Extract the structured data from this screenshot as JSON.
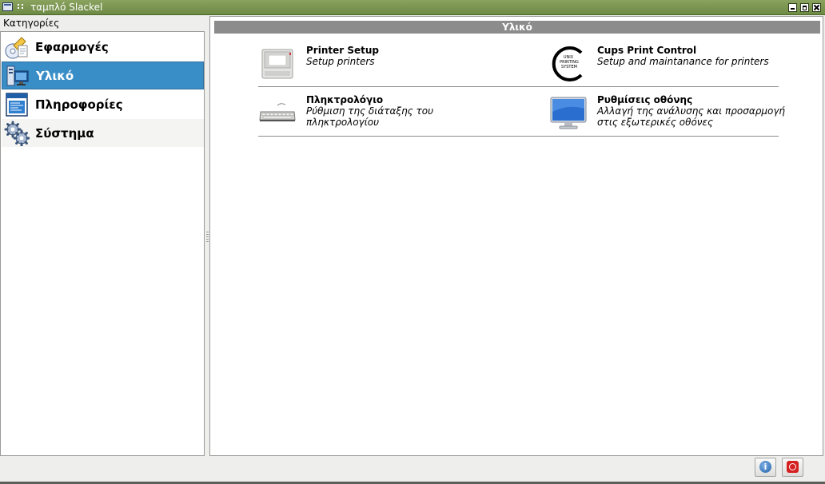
{
  "window": {
    "title": "ταμπλό Slackel"
  },
  "sidebar": {
    "label": "Κατηγορίες",
    "items": [
      {
        "label": "Εφαρμογές",
        "icon": "applications-icon",
        "selected": false
      },
      {
        "label": "Υλικό",
        "icon": "hardware-icon",
        "selected": true
      },
      {
        "label": "Πληροφορίες",
        "icon": "information-icon",
        "selected": false
      },
      {
        "label": "Σύστημα",
        "icon": "system-gears-icon",
        "selected": false
      }
    ]
  },
  "main": {
    "section_title": "Υλικό",
    "apps": [
      {
        "title": "Printer Setup",
        "description": "Setup printers",
        "icon": "printer-icon"
      },
      {
        "title": "Cups Print Control",
        "description": "Setup and maintanance for printers",
        "icon": "cups-icon"
      },
      {
        "title": "Πληκτρολόγιο",
        "description": "Ρύθμιση της διάταξης του πληκτρολογίου",
        "icon": "keyboard-icon"
      },
      {
        "title": "Ρυθμίσεις οθόνης",
        "description": "Αλλαγή της ανάλυσης και προσαρμογή στις εξωτερικές οθόνες",
        "icon": "monitor-icon"
      }
    ],
    "cups_logo_text": "UNIX PRINTING SYSTEM"
  },
  "footer": {
    "info_glyph": "i",
    "quit_glyph": ""
  },
  "colors": {
    "titlebar": "#7a9650",
    "selection": "#3a8ec8",
    "section_header": "#8c8c8c"
  }
}
